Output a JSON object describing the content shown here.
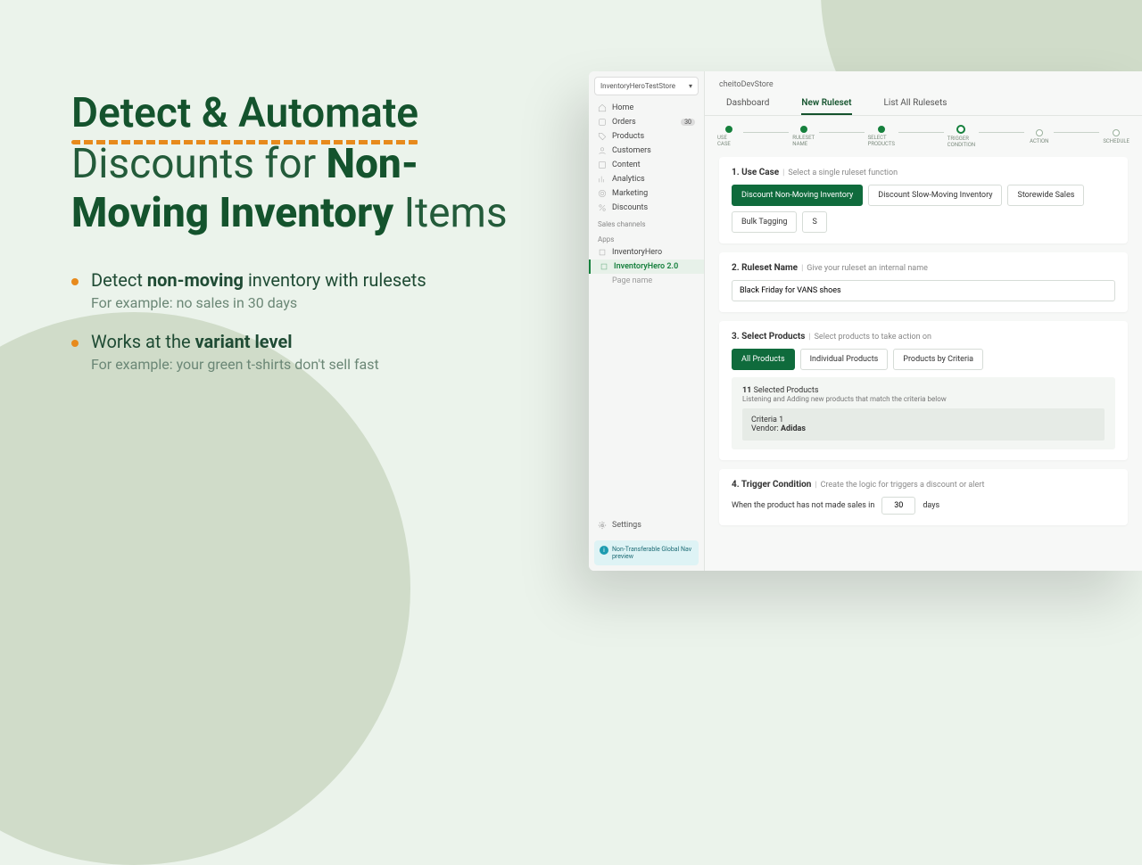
{
  "headline": {
    "line1": "Detect & Automate",
    "line2_pre": "Discounts for ",
    "line2_bold": "Non-Moving Inventory",
    "line2_post": " Items"
  },
  "bullets": [
    {
      "main_pre": "Detect ",
      "main_bold": "non-moving",
      "main_post": " inventory with rulesets",
      "sub_pre": "For example: ",
      "sub": "no sales in 30 days"
    },
    {
      "main_pre": "Works at the ",
      "main_bold": "variant level",
      "main_post": "",
      "sub_pre": "For example: ",
      "sub": "your green t-shirts don't sell fast"
    }
  ],
  "app": {
    "store_selector": "InventoryHeroTestStore",
    "nav": {
      "home": "Home",
      "orders": "Orders",
      "orders_count": "30",
      "products": "Products",
      "customers": "Customers",
      "content": "Content",
      "analytics": "Analytics",
      "marketing": "Marketing",
      "discounts": "Discounts",
      "sales_channels": "Sales channels",
      "apps": "Apps",
      "app1": "InventoryHero",
      "app2": "InventoryHero 2.0",
      "page": "Page name",
      "settings": "Settings"
    },
    "info_card": "Non-Transferable Global Nav preview",
    "breadcrumb": "cheitoDevStore",
    "tabs": {
      "dashboard": "Dashboard",
      "new": "New Ruleset",
      "list": "List All Rulesets"
    },
    "steps": {
      "use_case": "USE CASE",
      "ruleset_name": "RULESET NAME",
      "select_products": "SELECT PRODUCTS",
      "trigger": "TRIGGER CONDITION",
      "action": "ACTION",
      "schedule": "SCHEDULE"
    },
    "section1": {
      "title": "1. Use Case",
      "sub": "Select a single ruleset function",
      "pills": [
        "Discount Non-Moving Inventory",
        "Discount Slow-Moving Inventory",
        "Storewide Sales",
        "Bulk Tagging",
        "S"
      ]
    },
    "section2": {
      "title": "2. Ruleset Name",
      "sub": "Give your ruleset an internal name",
      "value": "Black Friday for VANS shoes"
    },
    "section3": {
      "title": "3. Select Products",
      "sub": "Select products to take action on",
      "pills": [
        "All Products",
        "Individual Products",
        "Products by Criteria"
      ],
      "selected_count": "11",
      "selected_label": "Selected Products",
      "listening": "Listening and Adding new products that match the criteria below",
      "crit_label": "Criteria 1",
      "crit_key": "Vendor:",
      "crit_val": "Adidas"
    },
    "section4": {
      "title": "4. Trigger Condition",
      "sub": "Create the logic for triggers a discount or alert",
      "text_pre": "When the product has not made sales in",
      "value": "30",
      "text_post": "days"
    }
  }
}
